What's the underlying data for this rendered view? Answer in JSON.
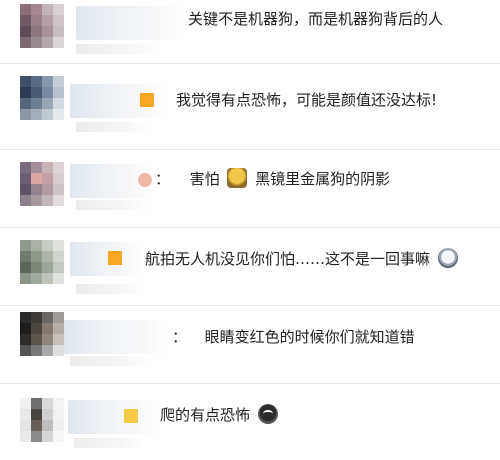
{
  "comments": [
    {
      "separator": "",
      "text": "关键不是机器狗，而是机器狗背后的人",
      "emoji": "",
      "emoji_inline_after": ""
    },
    {
      "separator": "",
      "text": "我觉得有点恐怖，可能是颜值还没达标!",
      "emoji": ""
    },
    {
      "separator": "：",
      "text_before": "害怕",
      "emoji": "worried-face",
      "text_after": "黑镜里金属狗的阴影"
    },
    {
      "separator": "",
      "text": "航拍无人机没见你们怕……这不是一回事嘛",
      "emoji": "scared-face"
    },
    {
      "separator": "：",
      "text": "眼睛变红色的时候你们就知道错",
      "emoji": ""
    },
    {
      "separator": "",
      "text": "爬的有点恐怖",
      "emoji": "crying-face"
    }
  ],
  "colors": {
    "text": "#222222",
    "divider": "#e8e8e8",
    "accent_chip": "#f5a623"
  }
}
